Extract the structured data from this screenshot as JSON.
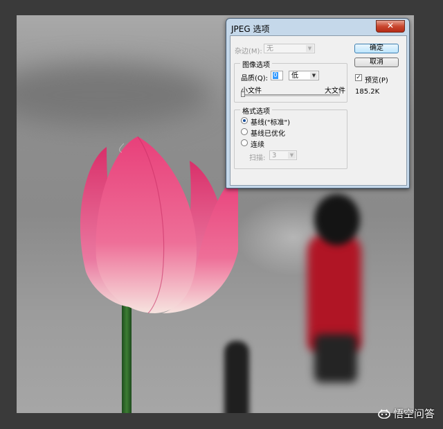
{
  "dialog": {
    "title": "JPEG 选项",
    "close_glyph": "✕",
    "matte": {
      "label": "杂边(M):",
      "value": "无"
    },
    "image_options": {
      "group_label": "图像选项",
      "quality_label": "品质(Q):",
      "quality_value": "0",
      "quality_preset": "低",
      "small_file": "小文件",
      "large_file": "大文件",
      "quality_level": 0
    },
    "format_options": {
      "group_label": "格式选项",
      "radios": [
        {
          "label": "基线(\"标准\")",
          "selected": true
        },
        {
          "label": "基线已优化",
          "selected": false
        },
        {
          "label": "连续",
          "selected": false
        }
      ],
      "scans_label": "扫描:",
      "scans_value": "3"
    },
    "buttons": {
      "ok": "确定",
      "cancel": "取消"
    },
    "preview": {
      "label": "预览(P)",
      "checked": true,
      "check_glyph": "✓"
    },
    "file_size": "185.2K"
  },
  "watermark": {
    "text": "悟空问答",
    "icon": "watermark-logo-icon"
  },
  "colors": {
    "title_bar": "#c5d8ea",
    "close": "#c9472f",
    "default_button": "#bee6fd",
    "lotus": "#e8467a",
    "shirt": "#b01525"
  }
}
